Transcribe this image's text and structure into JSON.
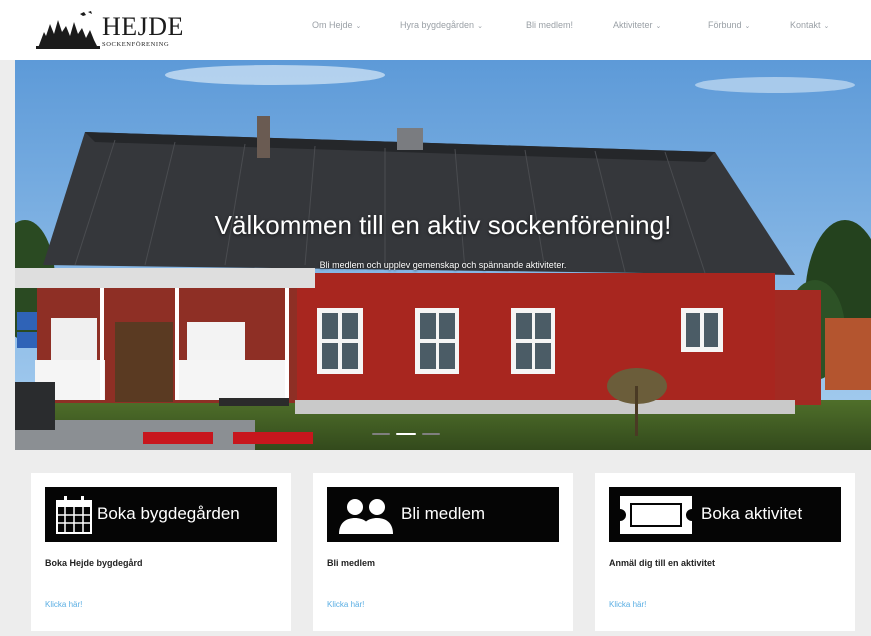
{
  "brand": {
    "title": "HEJDE",
    "subtitle": "SOCKENFÖRENING"
  },
  "nav": [
    {
      "label": "Om Hejde",
      "has_dropdown": true
    },
    {
      "label": "Hyra bygdegården",
      "has_dropdown": true
    },
    {
      "label": "Bli medlem!",
      "has_dropdown": false
    },
    {
      "label": "Aktiviteter",
      "has_dropdown": true
    },
    {
      "label": "Förbund",
      "has_dropdown": true
    },
    {
      "label": "Kontakt",
      "has_dropdown": true
    }
  ],
  "hero": {
    "title": "Välkommen till en aktiv sockenförening!",
    "subtitle": "Bli medlem och upplev gemenskap och spännande aktiviteter."
  },
  "cards": [
    {
      "banner": "Boka bygdegården",
      "title": "Boka Hejde bygdegård",
      "link": "Klicka här!",
      "icon": "calendar-icon"
    },
    {
      "banner": "Bli medlem",
      "title": "Bli medlem",
      "link": "Klicka här!",
      "icon": "people-icon"
    },
    {
      "banner": "Boka aktivitet",
      "title": "Anmäl dig till en aktivitet",
      "link": "Klicka här!",
      "icon": "ticket-icon"
    }
  ],
  "colors": {
    "link": "#5aaee3",
    "banner": "#050505",
    "house_red": "#a8261f",
    "roof": "#2f3135",
    "sky": "#7fb6e4"
  }
}
